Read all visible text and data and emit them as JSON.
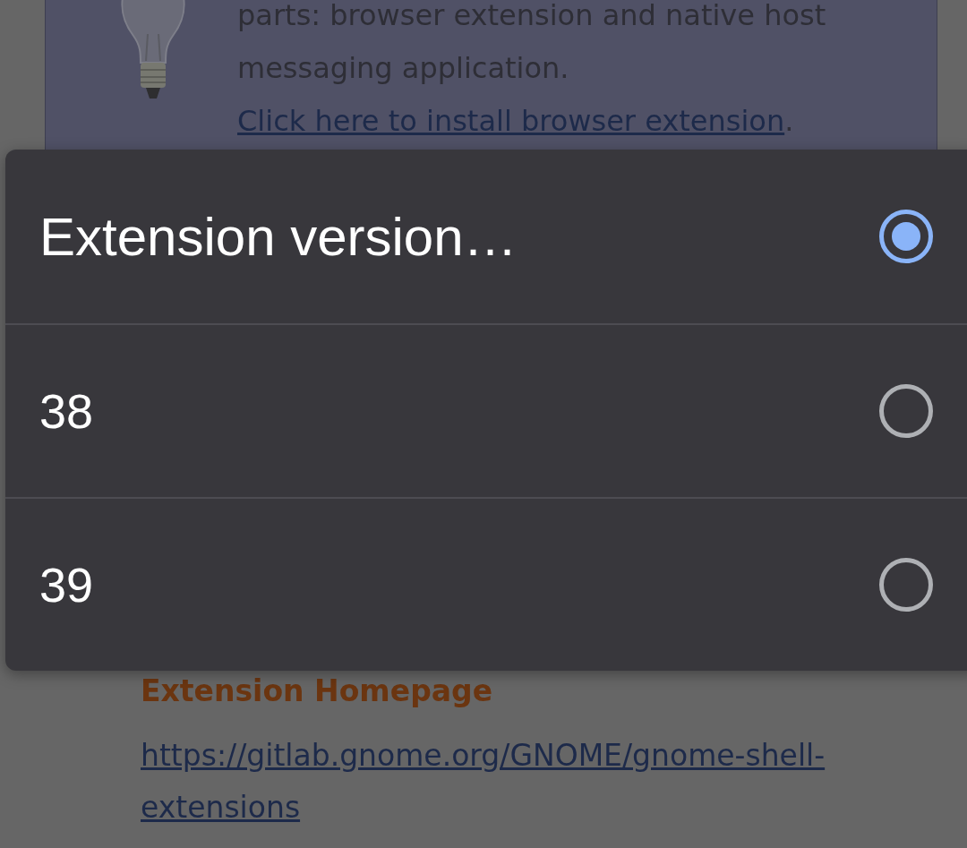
{
  "info_box": {
    "lines": [
      "parts: browser extension and native host",
      "messaging application."
    ],
    "install_link": "Click here to install browser extension",
    "link_suffix": "."
  },
  "extension_homepage": {
    "heading": "Extension Homepage",
    "link": "https://gitlab.gnome.org/GNOME/gnome-shell-extensions"
  },
  "version_menu": {
    "options": [
      {
        "label": "Extension version…",
        "selected": true
      },
      {
        "label": "38",
        "selected": false
      },
      {
        "label": "39",
        "selected": false
      }
    ]
  }
}
